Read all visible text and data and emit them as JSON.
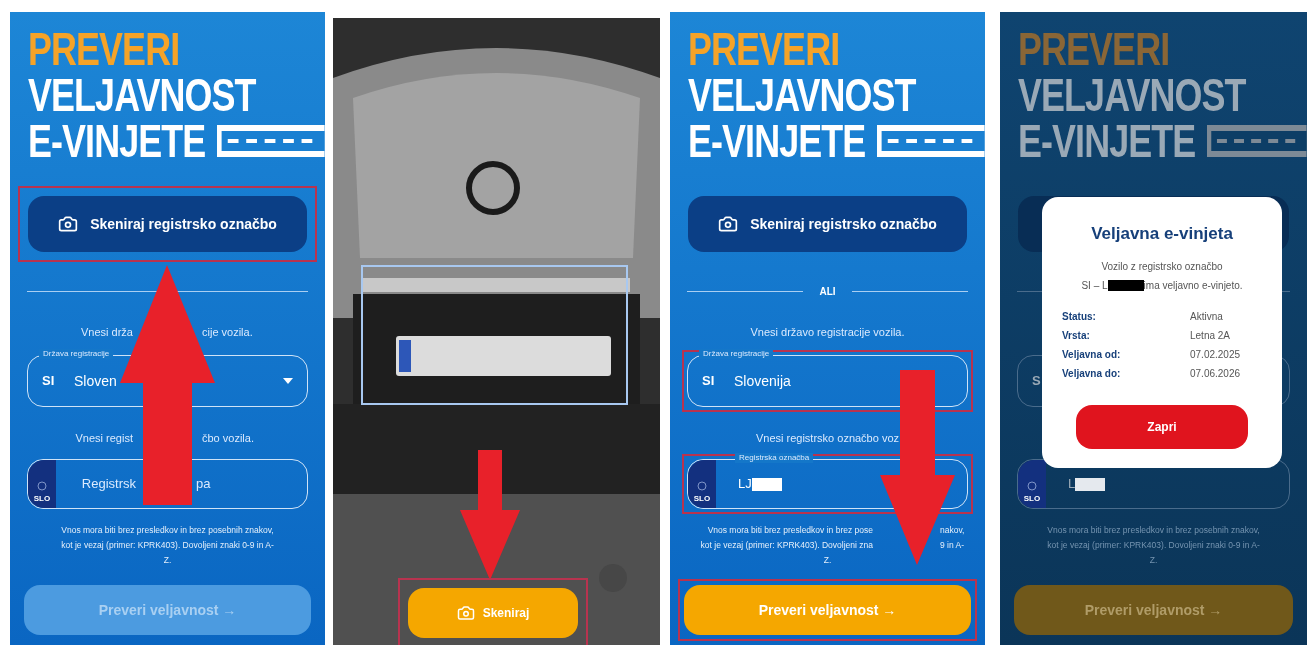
{
  "panels": [
    {
      "kind": "form",
      "dimmed": false,
      "annotation": {
        "kind": "arrow-up"
      },
      "title": {
        "accent": "PREVERI",
        "lines": [
          "VELJAVNOST",
          "E-VINJETE"
        ]
      },
      "scan_button": {
        "label": "Skeniraj registrsko označbo",
        "highlighted": true
      },
      "country_prompt": [
        "Vnesi drža",
        "cije vozila."
      ],
      "country_select": {
        "label": "Država registracije",
        "code": "SI",
        "value": "Sloven",
        "highlighted": false
      },
      "plate_prompt": [
        "Vnesi regist",
        "čbo vozila."
      ],
      "plate_input": {
        "badge": "SLO",
        "placeholder": [
          "Registrsk",
          "pa"
        ],
        "highlighted": false
      },
      "hint": [
        [
          "Vnos mora biti brez presledkov in brez posebnih znakov,"
        ],
        [
          "kot je vezaj (primer: KPRK403). Dovoljeni znaki 0-9 in A-"
        ],
        [
          "Z."
        ]
      ],
      "submit_button": {
        "label": "Preveri veljavnost →",
        "enabled": false,
        "highlighted": false
      }
    },
    {
      "kind": "camera",
      "annotation": {
        "kind": "arrow-down"
      },
      "scan_button": {
        "label": "Skeniraj",
        "highlighted": true
      }
    },
    {
      "kind": "form",
      "dimmed": false,
      "annotation": {
        "kind": "arrow-down"
      },
      "title": {
        "accent": "PREVERI",
        "lines": [
          "VELJAVNOST",
          "E-VINJETE"
        ]
      },
      "scan_button": {
        "label": "Skeniraj registrsko označbo",
        "highlighted": false
      },
      "divider_label": "ALI",
      "country_prompt": [
        "Vnesi državo registracije vozila."
      ],
      "country_select": {
        "label": "Država registracije",
        "code": "SI",
        "value": "Slovenija",
        "highlighted": true
      },
      "plate_prompt": [
        "Vnesi registrsko označbo voz"
      ],
      "plate_input": {
        "badge": "SLO",
        "label": "Registrska označba",
        "value": "LJ",
        "redacted": true,
        "highlighted": true
      },
      "hint": [
        [
          "Vnos mora biti brez presledkov in brez pose",
          "nakov,"
        ],
        [
          "kot je vezaj (primer: KPRK403). Dovoljeni zna",
          "9 in A-"
        ],
        [
          "Z."
        ]
      ],
      "submit_button": {
        "label": "Preveri veljavnost →",
        "enabled": true,
        "highlighted": true
      }
    },
    {
      "kind": "form",
      "dimmed": true,
      "title": {
        "accent": "PREVERI",
        "lines": [
          "VELJAVNOST",
          "E-VINJETE"
        ]
      },
      "scan_button": {
        "highlighted": false
      },
      "country_select": {
        "code": "S",
        "highlighted": false
      },
      "plate_input": {
        "badge": "SLO",
        "value": "L",
        "redacted": true,
        "highlighted": false
      },
      "hint": [
        [
          "Vnos mora biti brez presledkov in brez posebnih znakov,"
        ],
        [
          "kot je vezaj (primer: KPRK403). Dovoljeni znaki 0-9 in A-"
        ],
        [
          "Z."
        ]
      ],
      "submit_button": {
        "label": "Preveri veljavnost →",
        "enabled": true,
        "highlighted": false
      },
      "modal": {
        "title": "Veljavna e-vinjeta",
        "message": [
          "Vozilo z registrsko označbo",
          "SI – L",
          "ima veljavno e-vinjeto."
        ],
        "redacted": true,
        "details": [
          {
            "label": "Status:",
            "value": "Aktivna"
          },
          {
            "label": "Vrsta:",
            "value": "Letna 2A"
          },
          {
            "label": "Veljavna od:",
            "value": "07.02.2025"
          },
          {
            "label": "Veljavna do:",
            "value": "07.06.2026"
          }
        ],
        "close_button": "Zapri"
      }
    }
  ]
}
